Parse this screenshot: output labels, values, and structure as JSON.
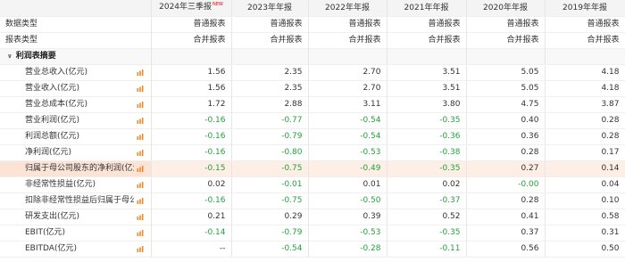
{
  "header": {
    "periods": [
      "2024年三季报",
      "2023年年报",
      "2022年年报",
      "2021年年报",
      "2020年年报",
      "2019年年报"
    ],
    "new_badge": "NEW"
  },
  "meta_rows": [
    {
      "label": "数据类型",
      "values": [
        "普通报表",
        "普通报表",
        "普通报表",
        "普通报表",
        "普通报表",
        "普通报表"
      ]
    },
    {
      "label": "报表类型",
      "values": [
        "合并报表",
        "合并报表",
        "合并报表",
        "合并报表",
        "合并报表",
        "合并报表"
      ]
    }
  ],
  "section": {
    "caret": "∨",
    "label": "利润表摘要"
  },
  "rows": [
    {
      "label": "营业总收入(亿元)",
      "values": [
        "1.56",
        "2.35",
        "2.70",
        "3.51",
        "5.05",
        "4.18"
      ]
    },
    {
      "label": "营业收入(亿元)",
      "values": [
        "1.56",
        "2.35",
        "2.70",
        "3.51",
        "5.05",
        "4.18"
      ]
    },
    {
      "label": "营业总成本(亿元)",
      "values": [
        "1.72",
        "2.88",
        "3.11",
        "3.80",
        "4.75",
        "3.87"
      ]
    },
    {
      "label": "营业利润(亿元)",
      "values": [
        "-0.16",
        "-0.77",
        "-0.54",
        "-0.35",
        "0.40",
        "0.28"
      ]
    },
    {
      "label": "利润总额(亿元)",
      "values": [
        "-0.16",
        "-0.79",
        "-0.54",
        "-0.36",
        "0.36",
        "0.28"
      ]
    },
    {
      "label": "净利润(亿元)",
      "values": [
        "-0.16",
        "-0.80",
        "-0.53",
        "-0.38",
        "0.28",
        "0.17"
      ]
    },
    {
      "label": "归属于母公司股东的净利润(亿元)",
      "values": [
        "-0.15",
        "-0.75",
        "-0.49",
        "-0.35",
        "0.27",
        "0.14"
      ],
      "highlight": true
    },
    {
      "label": "非经常性损益(亿元)",
      "values": [
        "0.02",
        "-0.01",
        "0.01",
        "0.02",
        "-0.00",
        "0.04"
      ]
    },
    {
      "label": "扣除非经常性损益后归属于母公司...",
      "values": [
        "-0.16",
        "-0.75",
        "-0.50",
        "-0.37",
        "0.28",
        "0.10"
      ]
    },
    {
      "label": "研发支出(亿元)",
      "values": [
        "0.21",
        "0.29",
        "0.39",
        "0.52",
        "0.41",
        "0.58"
      ]
    },
    {
      "label": "EBIT(亿元)",
      "values": [
        "-0.14",
        "-0.79",
        "-0.53",
        "-0.35",
        "0.37",
        "0.31"
      ]
    },
    {
      "label": "EBITDA(亿元)",
      "values": [
        "--",
        "-0.54",
        "-0.28",
        "-0.11",
        "0.56",
        "0.50"
      ]
    }
  ],
  "colors": {
    "negative": "#21a33a",
    "highlight_row": "#fdeee6",
    "icon": "#f08a24",
    "new_badge": "#e60012"
  },
  "icons": {
    "row_chart": "bar-chart-icon"
  }
}
